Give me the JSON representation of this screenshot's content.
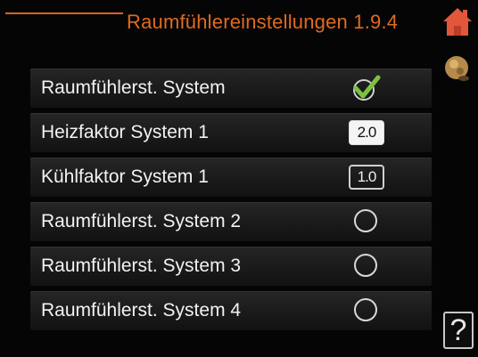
{
  "header": {
    "title": "Raumfühlereinstellungen 1.9.4",
    "accent_color": "#e06a1f",
    "home_icon": "home-icon",
    "nav_icon": "navigation-knob-icon",
    "help_icon": "help-icon",
    "help_text": "?"
  },
  "rows": [
    {
      "label": "Raumfühlerst. System",
      "control": "checkbox",
      "checked": true
    },
    {
      "label": "Heizfaktor System 1",
      "control": "value",
      "value": "2.0",
      "selected": true
    },
    {
      "label": "Kühlfaktor System 1",
      "control": "value",
      "value": "1.0",
      "selected": false
    },
    {
      "label": "Raumfühlerst. System 2",
      "control": "radio",
      "checked": false
    },
    {
      "label": "Raumfühlerst. System 3",
      "control": "radio",
      "checked": false
    },
    {
      "label": "Raumfühlerst. System 4",
      "control": "radio",
      "checked": false
    }
  ]
}
